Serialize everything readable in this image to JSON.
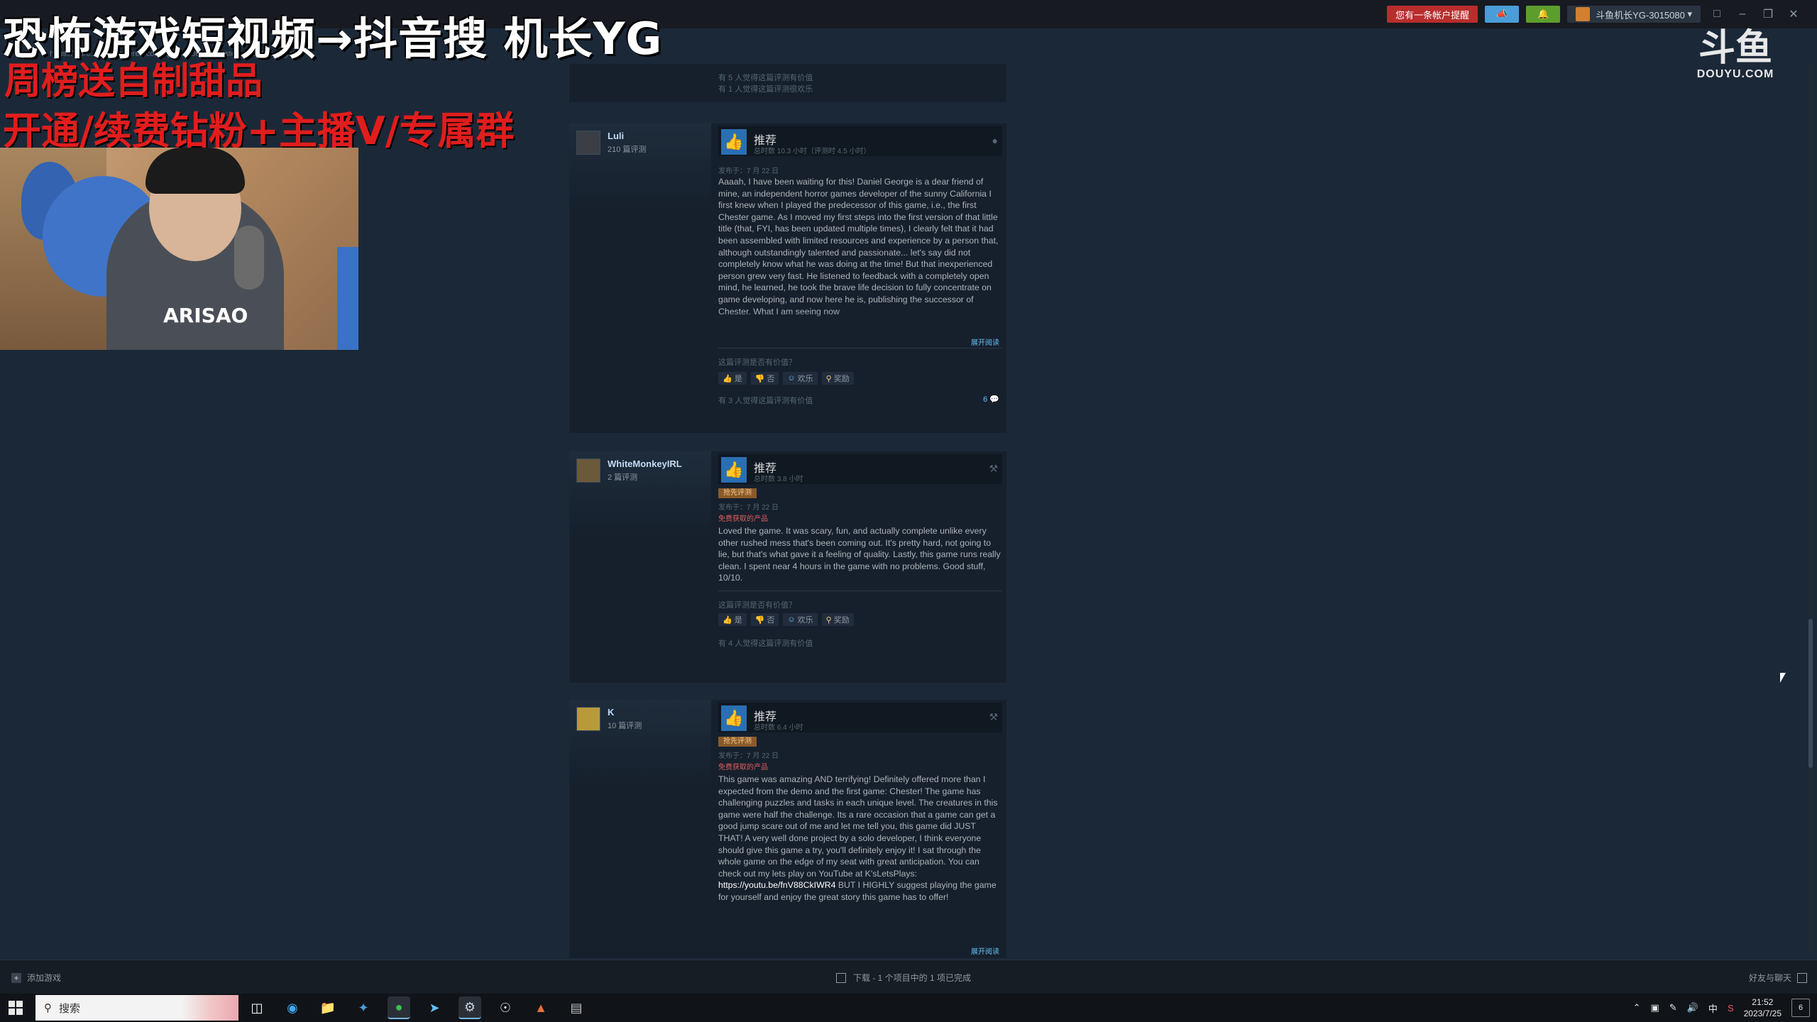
{
  "titlebar": {
    "url": "https://store.steampowered.com/app/2238690/Chester_Into_The_Light/",
    "notice": "您有一条帐户提醒",
    "account": "斗鱼机长YG-3015080"
  },
  "overlay": {
    "line1": "恐怖游戏短视频→抖音搜 机长YG",
    "line2": "周榜送自制甜品",
    "line3": "开通/续费钻粉+主播V/专属群"
  },
  "webcam": {
    "shirt_print": "ARISAO"
  },
  "logo": {
    "mark": "斗鱼",
    "text": "DOUYU.COM"
  },
  "top_fragment": {
    "line1": "有 5 人觉得这篇评测有价值",
    "line2": "有 1 人觉得这篇评测很欢乐"
  },
  "reviews": [
    {
      "user": "Luli",
      "count": "210 篇评测",
      "recommend": "推荐",
      "hours": "总时数 10.3 小时（评测时 4.5 小时）",
      "posted": "发布于：7 月 22 日",
      "text": "Aaaah, I have been waiting for this! Daniel George is a dear friend of mine, an independent horror games developer of the sunny California I first knew when I played the predecessor of this game, i.e., the first Chester game. As I moved my first steps into the first version of that little title (that, FYI, has been updated multiple times), I clearly felt that it had been assembled with limited resources and experience by a person that, although outstandingly talented and passionate... let's say did not completely know what he was doing at the time! But that inexperienced person grew very fast. He listened to feedback with a completely open mind, he learned, he took the brave life decision to fully concentrate on game developing, and now here he is, publishing the successor of Chester. What I am seeing now",
      "readmore": "展开阅读",
      "helpful_q": "这篇评测是否有价值？",
      "yes": "是",
      "no": "否",
      "funny": "欢乐",
      "award": "奖励",
      "helpful_count": "有 3 人觉得这篇评测有价值",
      "comments": "6"
    },
    {
      "user": "WhiteMonkeyIRL",
      "count": "2 篇评测",
      "recommend": "推荐",
      "hours": "总时数 3.8 小时",
      "tag": "抢先评测",
      "posted": "发布于：7 月 22 日",
      "free": "免费获取的产品",
      "text": "Loved the game. It was scary, fun, and actually complete unlike every other rushed mess that's been coming out. It's pretty hard, not going to lie, but that's what gave it a feeling of quality. Lastly, this game runs really clean. I spent near 4 hours in the game with no problems. Good stuff, 10/10.",
      "helpful_q": "这篇评测是否有价值？",
      "yes": "是",
      "no": "否",
      "funny": "欢乐",
      "award": "奖励",
      "helpful_count": "有 4 人觉得这篇评测有价值"
    },
    {
      "user": "K",
      "count": "10 篇评测",
      "recommend": "推荐",
      "hours": "总时数 6.4 小时",
      "tag": "抢先评测",
      "posted": "发布于：7 月 22 日",
      "free": "免费获取的产品",
      "text_before": "This game was amazing AND terrifying! Definitely offered more than I expected from the demo and the first game: Chester! The game has challenging puzzles and tasks in each unique level. The creatures in this game were half the challenge. Its a rare occasion that a game can get a good jump scare out of me and let me tell you, this game did JUST THAT! A very well done project by a solo developer, I think everyone should give this game a try, you'll definitely enjoy it! I sat through the whole game on the edge of my seat with great anticipation. You can check out my lets play on YouTube at K'sLetsPlays: ",
      "link": "https://youtu.be/fnV88CkIWR4",
      "text_after": " BUT I HIGHLY suggest playing the game for yourself and enjoy the great story this game has to offer!",
      "readmore": "展开阅读"
    }
  ],
  "steam_bottom": {
    "add_game": "添加游戏",
    "download": "下载 - 1 个项目中的 1 项已完成",
    "friends": "好友与聊天"
  },
  "taskbar": {
    "search": "搜索",
    "ime": "中",
    "time": "21:52",
    "date": "2023/7/25",
    "notifications": "6"
  }
}
